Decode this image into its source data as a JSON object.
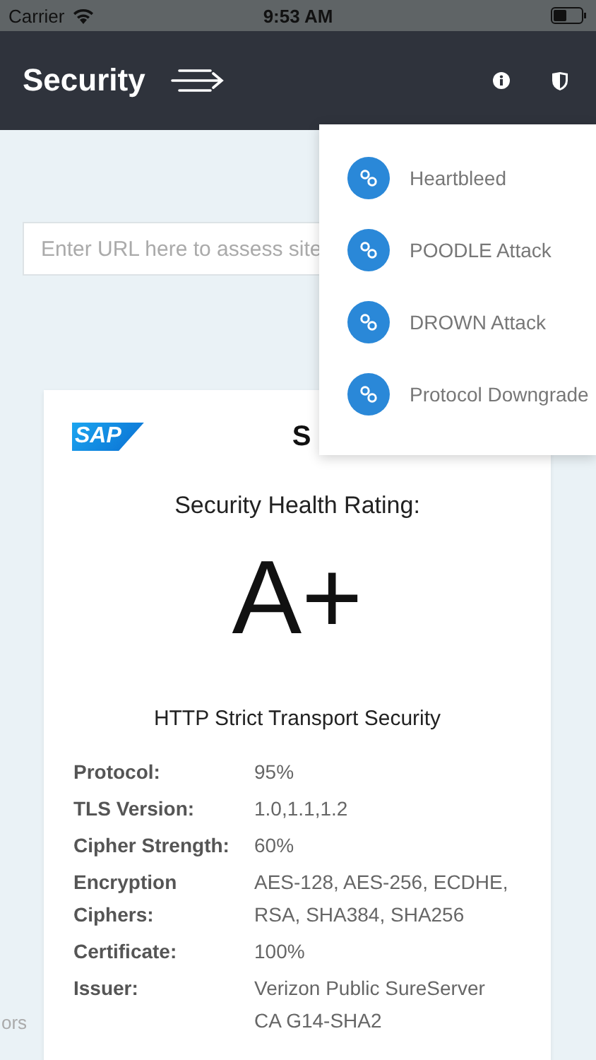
{
  "status_bar": {
    "carrier": "Carrier",
    "time": "9:53 AM"
  },
  "header": {
    "title": "Security"
  },
  "search": {
    "placeholder": "Enter URL here to assess site"
  },
  "menu": {
    "items": [
      {
        "label": "Heartbleed"
      },
      {
        "label": "POODLE Attack"
      },
      {
        "label": "DROWN Attack"
      },
      {
        "label": "Protocol Downgrade"
      }
    ]
  },
  "side_text": "ors",
  "card": {
    "logo": "SAP",
    "title": "S",
    "rating_label": "Security Health Rating:",
    "grade": "A+",
    "policy": "HTTP Strict Transport Security",
    "rows": [
      {
        "label": "Protocol:",
        "value": "95%"
      },
      {
        "label": "TLS Version:",
        "value": "1.0,1.1,1.2"
      },
      {
        "label": "Cipher Strength:",
        "value": "60%"
      },
      {
        "label": "Encryption Ciphers:",
        "value": "AES-128, AES-256, ECDHE, RSA, SHA384, SHA256"
      },
      {
        "label": "Certificate:",
        "value": "100%"
      },
      {
        "label": "Issuer:",
        "value": "Verizon Public SureServer CA G14-SHA2"
      }
    ]
  }
}
